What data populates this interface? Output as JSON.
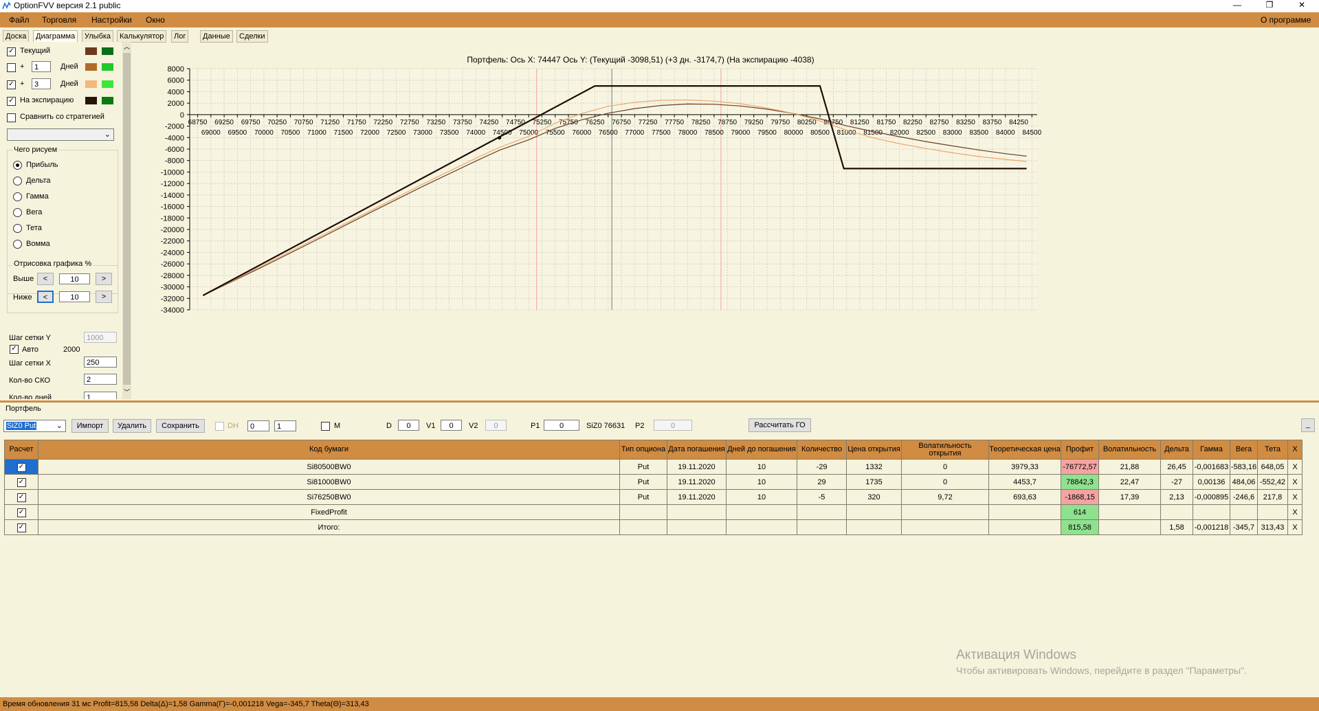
{
  "window": {
    "title": "OptionFVV версия 2.1 public",
    "minimize": "—",
    "maximize": "❐",
    "close": "✕"
  },
  "menu": {
    "items": [
      "Файл",
      "Торговля",
      "Настройки",
      "Окно"
    ],
    "about": "О программе"
  },
  "tabs": [
    "Доска",
    "Диаграмма",
    "Улыбка",
    "Калькулятор",
    "Лог",
    "Данные",
    "Сделки"
  ],
  "left_panel": {
    "rows": [
      {
        "label": "Текущий",
        "checked": true,
        "colors": [
          "#6b3a1c",
          "#0a6f18"
        ]
      },
      {
        "prefix": "+",
        "value": "1",
        "suffix": "Дней",
        "checked": false,
        "colors": [
          "#b06a2c",
          "#22c82c"
        ]
      },
      {
        "prefix": "+",
        "value": "3",
        "suffix": "Дней",
        "checked": true,
        "colors": [
          "#f4b87a",
          "#3ce63c"
        ]
      },
      {
        "label": "На экспирацию",
        "checked": true,
        "colors": [
          "#2a1406",
          "#0a7a12"
        ]
      }
    ],
    "compare_label": "Сравнить со стратегией",
    "what_title": "Чего рисуем",
    "radios": [
      "Прибыль",
      "Дельта",
      "Гамма",
      "Вега",
      "Тета",
      "Вомма"
    ],
    "selected_radio": "Прибыль",
    "render_title": "Отрисовка графика %",
    "above_label": "Выше",
    "above_value": "10",
    "below_label": "Ниже",
    "below_value": "10",
    "arrow_left": "<",
    "arrow_right": ">",
    "grid_y_label": "Шаг сетки Y",
    "grid_y_value": "1000",
    "auto_label": "Авто",
    "auto_value": "2000",
    "grid_x_label": "Шаг сетки X",
    "grid_x_value": "250",
    "sko_label": "Кол-во СКО",
    "sko_value": "2",
    "days_label": "Кол-во дней",
    "days_value": "1"
  },
  "chart_data": {
    "type": "line",
    "title": "Портфель:  Ось X:  74447  Ось Y:   (Текущий -3098,51)   (+3 дн. -3174,7)   (На экспирацию -4038)",
    "xlim": [
      68600,
      84600
    ],
    "ylim": [
      -34000,
      8000
    ],
    "yticks": [
      8000,
      6000,
      4000,
      2000,
      0,
      -2000,
      -4000,
      -6000,
      -8000,
      -10000,
      -12000,
      -14000,
      -16000,
      -18000,
      -20000,
      -22000,
      -24000,
      -26000,
      -28000,
      -30000,
      -32000,
      -34000
    ],
    "xticks_top": [
      68750,
      69250,
      69750,
      70250,
      70750,
      71250,
      71750,
      72250,
      72750,
      73250,
      73750,
      74250,
      74750,
      75250,
      75750,
      76250,
      76750,
      77250,
      77750,
      78250,
      78750,
      79250,
      79750,
      80250,
      80750,
      81250,
      81750,
      82250,
      82750,
      83250,
      83750,
      84250
    ],
    "xticks_bottom": [
      69000,
      69500,
      70000,
      70500,
      71000,
      71500,
      72000,
      72500,
      73000,
      73500,
      74000,
      74500,
      75000,
      75500,
      76000,
      76500,
      77000,
      77500,
      78000,
      78500,
      79000,
      79500,
      80000,
      80500,
      81000,
      81500,
      82000,
      82500,
      83000,
      83500,
      84000,
      84500
    ],
    "vlines": [
      {
        "x": 75150,
        "color": "#f2a0a0"
      },
      {
        "x": 76570,
        "color": "#6a7f70"
      },
      {
        "x": 78630,
        "color": "#f2a0a0"
      }
    ],
    "marker": {
      "x": 74447,
      "y": -4038
    },
    "grid": true,
    "series": [
      {
        "color": "#1d0d03",
        "width": 2.2,
        "points": [
          [
            68850,
            -31500
          ],
          [
            76250,
            5000
          ],
          [
            80500,
            5000
          ],
          [
            80950,
            -9400
          ],
          [
            84400,
            -9400
          ]
        ]
      },
      {
        "color": "#f0a56a",
        "width": 1.2,
        "points": [
          [
            68850,
            -31500
          ],
          [
            70000,
            -26200
          ],
          [
            71000,
            -21500
          ],
          [
            72000,
            -16800
          ],
          [
            73000,
            -12100
          ],
          [
            74000,
            -7600
          ],
          [
            74447,
            -5700
          ],
          [
            75000,
            -3800
          ],
          [
            75500,
            -1500
          ],
          [
            76000,
            200
          ],
          [
            76500,
            1450
          ],
          [
            77000,
            2150
          ],
          [
            77500,
            2500
          ],
          [
            78000,
            2550
          ],
          [
            78500,
            2350
          ],
          [
            79000,
            1900
          ],
          [
            79500,
            1150
          ],
          [
            80000,
            200
          ],
          [
            80500,
            -1100
          ],
          [
            81000,
            -2700
          ],
          [
            81500,
            -4050
          ],
          [
            82000,
            -5050
          ],
          [
            82500,
            -5900
          ],
          [
            83000,
            -6650
          ],
          [
            83500,
            -7300
          ],
          [
            84000,
            -7800
          ],
          [
            84400,
            -8150
          ]
        ]
      },
      {
        "color": "#6a3d26",
        "width": 1.2,
        "points": [
          [
            68850,
            -31500
          ],
          [
            70000,
            -26400
          ],
          [
            71000,
            -21800
          ],
          [
            72000,
            -17100
          ],
          [
            73000,
            -12500
          ],
          [
            74000,
            -8100
          ],
          [
            74447,
            -6200
          ],
          [
            75000,
            -4400
          ],
          [
            75500,
            -2400
          ],
          [
            76000,
            -900
          ],
          [
            76500,
            250
          ],
          [
            77000,
            1050
          ],
          [
            77500,
            1600
          ],
          [
            78000,
            1850
          ],
          [
            78500,
            1800
          ],
          [
            79000,
            1500
          ],
          [
            79500,
            950
          ],
          [
            80000,
            200
          ],
          [
            80500,
            -750
          ],
          [
            81000,
            -1950
          ],
          [
            81500,
            -2950
          ],
          [
            82000,
            -3850
          ],
          [
            82500,
            -4700
          ],
          [
            83000,
            -5450
          ],
          [
            83500,
            -6150
          ],
          [
            84000,
            -6800
          ],
          [
            84400,
            -7250
          ]
        ]
      }
    ]
  },
  "portfolio": {
    "label": "Портфель",
    "select_value": "SiZ0 Put",
    "import_btn": "Импорт",
    "delete_btn": "Удалить",
    "save_btn": "Сохранить",
    "dh_label": "DH",
    "spin1": "0",
    "spin2": "1",
    "m_label": "M",
    "d_label": "D",
    "d_value": "0",
    "v1_label": "V1",
    "v1_value": "0",
    "v2_label": "V2",
    "v2_value": "0",
    "p1_label": "P1",
    "p1_value": "0",
    "price_label": "SiZ0 76631",
    "p2_label": "P2",
    "p2_value": "0",
    "calc_btn": "Рассчитать ГО",
    "small_btn": "_"
  },
  "table": {
    "headers": [
      "Расчет",
      "Код бумаги",
      "Тип опциона",
      "Дата погашения",
      "Дней до погашения",
      "Количество",
      "Цена открытия",
      "Волатильность открытия",
      "Теоретическая цена",
      "Профит",
      "Волатильность",
      "Дельта",
      "Гамма",
      "Вега",
      "Тета",
      "X"
    ],
    "rows": [
      {
        "cells": [
          "Si80500BW0",
          "Put",
          "19.11.2020",
          "10",
          "-29",
          "1332",
          "0",
          "3979,33",
          "-76772,57",
          "21,88",
          "26,45",
          "-0,001683",
          "-583,16",
          "648,05"
        ],
        "profit_color": "#f4a3a3"
      },
      {
        "cells": [
          "Si81000BW0",
          "Put",
          "19.11.2020",
          "10",
          "29",
          "1735",
          "0",
          "4453,7",
          "78842,3",
          "22,47",
          "-27",
          "0,00136",
          "484,06",
          "-552,42"
        ],
        "profit_color": "#8fe18f"
      },
      {
        "cells": [
          "Si76250BW0",
          "Put",
          "19.11.2020",
          "10",
          "-5",
          "320",
          "9,72",
          "693,63",
          "-1868,15",
          "17,39",
          "2,13",
          "-0,000895",
          "-246,6",
          "217,8"
        ],
        "profit_color": "#f4a3a3"
      },
      {
        "cells": [
          "FixedProfit",
          "",
          "",
          "",
          "",
          "",
          "",
          "",
          "614",
          "",
          "",
          "",
          "",
          ""
        ],
        "profit_color": "#8fe18f"
      },
      {
        "cells": [
          "Итого:",
          "",
          "",
          "",
          "",
          "",
          "",
          "",
          "815,58",
          "",
          "1,58",
          "-0,001218",
          "-345,7",
          "313,43"
        ],
        "profit_color": "#8fe18f"
      }
    ],
    "delete_glyph": "X"
  },
  "watermark": {
    "line1": "Активация Windows",
    "line2": "Чтобы активировать Windows, перейдите в раздел \"Параметры\"."
  },
  "status": {
    "text": "Время обновления 31 мс  Profit=815,58 Delta(Δ)=1,58 Gamma(Γ)=-0,001218 Vega=-345,7 Theta(Θ)=313,43"
  }
}
